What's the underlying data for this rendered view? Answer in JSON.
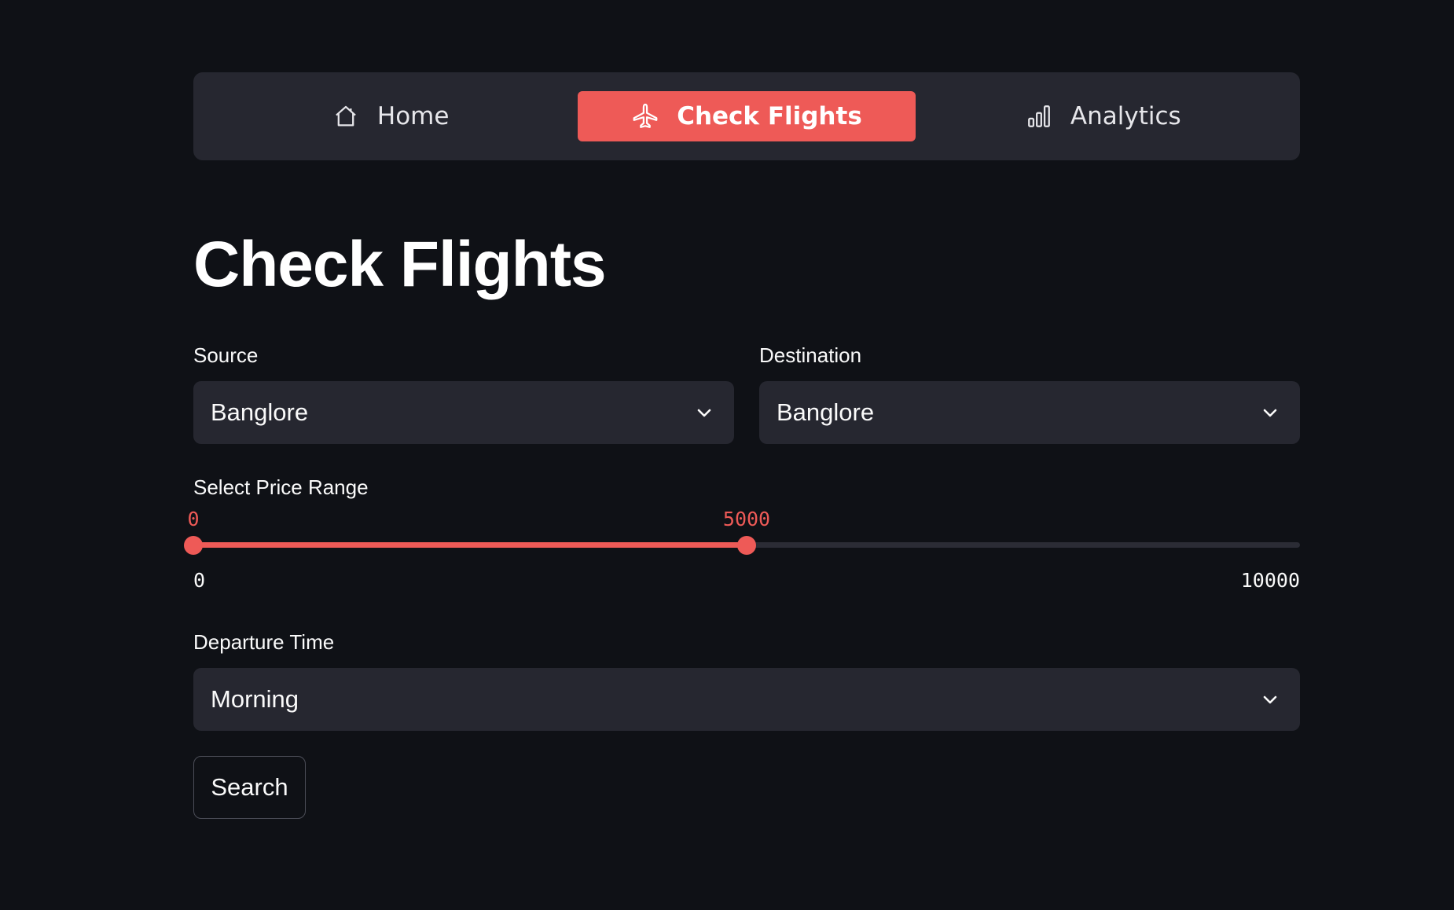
{
  "nav": {
    "items": [
      {
        "label": "Home",
        "icon": "home-icon",
        "active": false
      },
      {
        "label": "Check Flights",
        "icon": "airplane-icon",
        "active": true
      },
      {
        "label": "Analytics",
        "icon": "bar-chart-icon",
        "active": false
      }
    ]
  },
  "page": {
    "title": "Check Flights"
  },
  "source": {
    "label": "Source",
    "value": "Banglore"
  },
  "destination": {
    "label": "Destination",
    "value": "Banglore"
  },
  "price_range": {
    "label": "Select Price Range",
    "low": 0,
    "high": 5000,
    "min": 0,
    "max": 10000,
    "low_text": "0",
    "high_text": "5000",
    "min_text": "0",
    "max_text": "10000"
  },
  "departure": {
    "label": "Departure Time",
    "value": "Morning"
  },
  "search_button": {
    "label": "Search"
  },
  "colors": {
    "accent": "#ee5a57",
    "background": "#0f1116",
    "surface": "#262730"
  }
}
